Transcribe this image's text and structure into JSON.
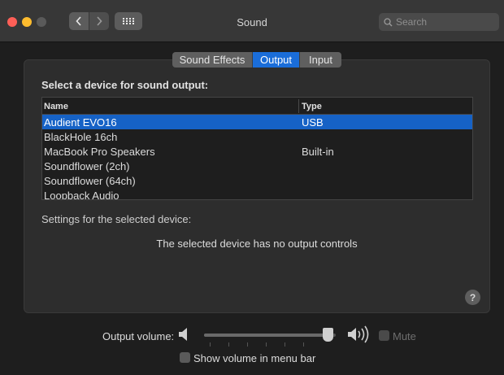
{
  "window": {
    "title": "Sound"
  },
  "search": {
    "placeholder": "Search"
  },
  "icons": {
    "back": "chevron-left-icon",
    "forward": "chevron-right-icon",
    "show_all": "grid-icon",
    "search": "magnifier-icon",
    "volume_low": "speaker-low-icon",
    "volume_high": "speaker-high-icon"
  },
  "colors": {
    "accent": "#1a6dd9",
    "selection": "#1662c6",
    "close": "#fe5f57",
    "minimize": "#febc2e"
  },
  "tabs": [
    {
      "label": "Sound Effects",
      "selected": false
    },
    {
      "label": "Output",
      "selected": true
    },
    {
      "label": "Input",
      "selected": false
    }
  ],
  "output": {
    "heading": "Select a device for sound output:",
    "columns": {
      "name": "Name",
      "type": "Type"
    },
    "devices": [
      {
        "name": "Audient EVO16",
        "type": "USB",
        "selected": true
      },
      {
        "name": "BlackHole 16ch",
        "type": ""
      },
      {
        "name": "MacBook Pro Speakers",
        "type": "Built-in"
      },
      {
        "name": "Soundflower (2ch)",
        "type": ""
      },
      {
        "name": "Soundflower (64ch)",
        "type": ""
      },
      {
        "name": "Loopback Audio",
        "type": ""
      }
    ],
    "settings_label": "Settings for the selected device:",
    "no_controls": "The selected device has no output controls",
    "help": "?"
  },
  "volume": {
    "label": "Output volume:",
    "level": 0.98,
    "mute_label": "Mute",
    "mute_checked": false,
    "show_in_menubar_label": "Show volume in menu bar",
    "show_in_menubar_checked": false
  }
}
